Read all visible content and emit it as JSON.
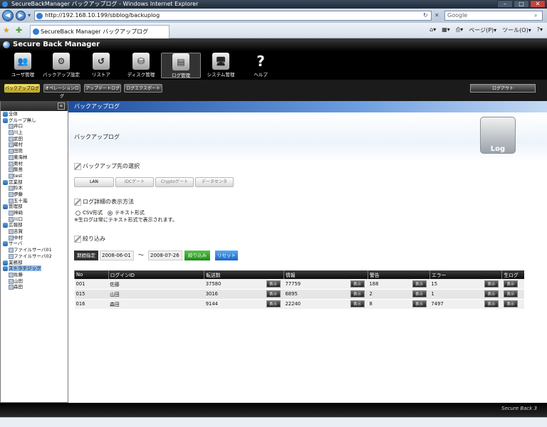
{
  "window": {
    "title": "SecureBackManager バックアップログ - Windows Internet Explorer"
  },
  "address": {
    "url": "http://192.168.10.199/sbblog/backuplog",
    "search_placeholder": "Google"
  },
  "tab": {
    "label": "SecureBack Manager バックアップログ"
  },
  "ie_tools": {
    "page": "ページ(P)",
    "tools": "ツール(O)"
  },
  "app": {
    "name": "Secure Back Manager"
  },
  "toolbar": [
    {
      "label": "ユーザ管理"
    },
    {
      "label": "バックアップ設定"
    },
    {
      "label": "リストア"
    },
    {
      "label": "ディスク管理"
    },
    {
      "label": "ログ管理"
    },
    {
      "label": "システム管理"
    },
    {
      "label": "ヘルプ"
    }
  ],
  "subnav": [
    {
      "label": "バックアップログ"
    },
    {
      "label": "オペレーションログ"
    },
    {
      "label": "アップデートログ"
    },
    {
      "label": "ログエクスポート"
    }
  ],
  "logout_label": "ログアウト",
  "sidebar": {
    "collapse": "«",
    "items": [
      {
        "label": "全体",
        "indent": 0,
        "kind": "group"
      },
      {
        "label": "グループ無し",
        "indent": 0,
        "kind": "group"
      },
      {
        "label": "井口",
        "indent": 1,
        "kind": "user"
      },
      {
        "label": "川上",
        "indent": 1,
        "kind": "user"
      },
      {
        "label": "武田",
        "indent": 1,
        "kind": "user"
      },
      {
        "label": "蔵村",
        "indent": 1,
        "kind": "user"
      },
      {
        "label": "田熊",
        "indent": 1,
        "kind": "user"
      },
      {
        "label": "東海林",
        "indent": 1,
        "kind": "user"
      },
      {
        "label": "奥村",
        "indent": 1,
        "kind": "user"
      },
      {
        "label": "飯島",
        "indent": 1,
        "kind": "user"
      },
      {
        "label": "test",
        "indent": 1,
        "kind": "user"
      },
      {
        "label": "営業部",
        "indent": 0,
        "kind": "group"
      },
      {
        "label": "鈴木",
        "indent": 1,
        "kind": "user"
      },
      {
        "label": "伊藤",
        "indent": 1,
        "kind": "user"
      },
      {
        "label": "五十嵐",
        "indent": 1,
        "kind": "user"
      },
      {
        "label": "管理部",
        "indent": 0,
        "kind": "group"
      },
      {
        "label": "神崎",
        "indent": 1,
        "kind": "user"
      },
      {
        "label": "川口",
        "indent": 1,
        "kind": "user"
      },
      {
        "label": "広報部",
        "indent": 0,
        "kind": "group"
      },
      {
        "label": "吉賀",
        "indent": 1,
        "kind": "user"
      },
      {
        "label": "中村",
        "indent": 1,
        "kind": "user"
      },
      {
        "label": "サーバ",
        "indent": 0,
        "kind": "group"
      },
      {
        "label": "ファイルサーバ01",
        "indent": 1,
        "kind": "user"
      },
      {
        "label": "ファイルサーバ02",
        "indent": 1,
        "kind": "user"
      },
      {
        "label": "業務部",
        "indent": 0,
        "kind": "group"
      },
      {
        "label": "ストラテジック",
        "indent": 0,
        "kind": "group",
        "selected": true
      },
      {
        "label": "佐藤",
        "indent": 1,
        "kind": "user"
      },
      {
        "label": "山田",
        "indent": 1,
        "kind": "user"
      },
      {
        "label": "森田",
        "indent": 1,
        "kind": "user"
      }
    ]
  },
  "main": {
    "header": "バックアップログ",
    "title": "バックアップログ",
    "log_icon_label": "Log",
    "dest_section": "バックアップ先の選択",
    "dest_options": [
      "LAN",
      "iDCゲート",
      "Cryptoゲート",
      "データセンタ"
    ],
    "detail_section": "ログ詳細の表示方法",
    "radio_csv": "CSV形式",
    "radio_text": "テキスト形式",
    "note": "※生ログは常にテキスト形式で表示されます。",
    "filter_section": "絞り込み",
    "period_label": "期間指定",
    "date_from": "2008-06-01",
    "tilde": "〜",
    "date_to": "2008-07-26",
    "filter_btn": "絞り込み",
    "reset_btn": "リセット",
    "show_label": "表示",
    "columns": [
      "No",
      "ログインID",
      "転送数",
      "情報",
      "警告",
      "エラー",
      "生ログ"
    ],
    "rows": [
      {
        "no": "001",
        "login": "佐藤",
        "transfer": "37580",
        "info": "77759",
        "warn": "188",
        "error": "15"
      },
      {
        "no": "015",
        "login": "山田",
        "transfer": "3016",
        "info": "6895",
        "warn": "2",
        "error": "1"
      },
      {
        "no": "016",
        "login": "森田",
        "transfer": "9144",
        "info": "22240",
        "warn": "8",
        "error": "7497"
      }
    ]
  },
  "footer": {
    "logo": "Secure Back 3"
  }
}
